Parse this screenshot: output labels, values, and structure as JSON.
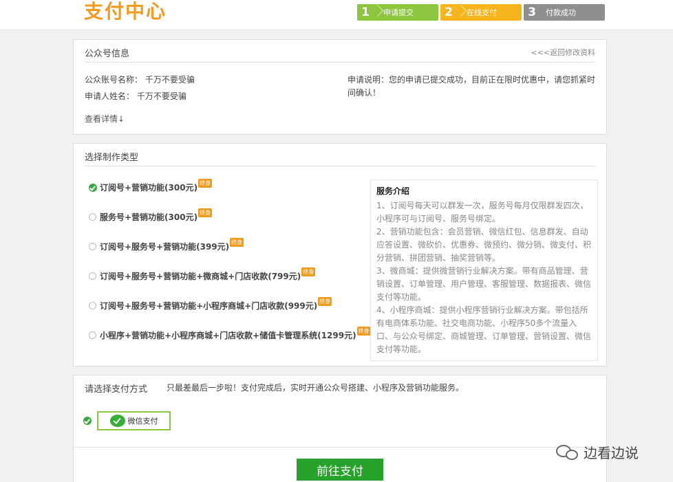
{
  "header": {
    "logo": "支付中心",
    "steps": [
      {
        "num": "1",
        "label": "申请提交"
      },
      {
        "num": "2",
        "label": "在线支付"
      },
      {
        "num": "3",
        "label": "付款成功"
      }
    ]
  },
  "account_panel": {
    "title": "公众号信息",
    "back_link": "<<<返回修改资料",
    "account_name": "公众账号名称： 千万不要受骗",
    "applicant_name": "申请人姓名： 千万不要受骗",
    "note": "申请说明：您的申请已提交成功，目前正在限时优惠中，请您抓紧时间确认！",
    "detail_link": "查看详情↓"
  },
  "type_panel": {
    "title": "选择制作类型",
    "badge": "终身",
    "options": [
      {
        "label": "订阅号+营销功能(300元)",
        "selected": true
      },
      {
        "label": "服务号+营销功能(300元)",
        "selected": false
      },
      {
        "label": "订阅号+服务号+营销功能(399元)",
        "selected": false
      },
      {
        "label": "订阅号+服务号+营销功能+微商城+门店收款(799元)",
        "selected": false
      },
      {
        "label": "订阅号+服务号+营销功能+小程序商城+门店收款(999元)",
        "selected": false
      },
      {
        "label": "小程序+营销功能+小程序商城+门店收款+储值卡管理系统(1299元)",
        "selected": false
      }
    ],
    "service": {
      "title": "服务介绍",
      "items": [
        "1、订阅号每天可以群发一次，服务号每月仅限群发四次，小程序可与订阅号、服务号绑定。",
        "2、营销功能包含：会员营销、微信红包、信息群发、自动应答设置、微砍价、优惠券、微预约、微分销、微支付、积分营销、拼团营销、抽奖营销等。",
        "3、微商城：提供微营销行业解决方案。带有商品管理、营销设置、订单管理、用户管理、客服管理、数据报表、微信支付等功能。",
        "4、小程序商城：提供小程序营销行业解决方案。带包括所有电商体系功能、社交电商功能、小程序50多个流量入口、与公众号绑定、商城管理、订单管理、营销设置、微信支付等功能。"
      ]
    }
  },
  "pay_panel": {
    "title": "请选择支付方式",
    "note": "只最差最后一步啦！支付完成后，实时开通公众号搭建、小程序及营销功能服务。",
    "wechat_label": "微信支付",
    "submit_label": "前往支付"
  },
  "watermark": "边看边说"
}
